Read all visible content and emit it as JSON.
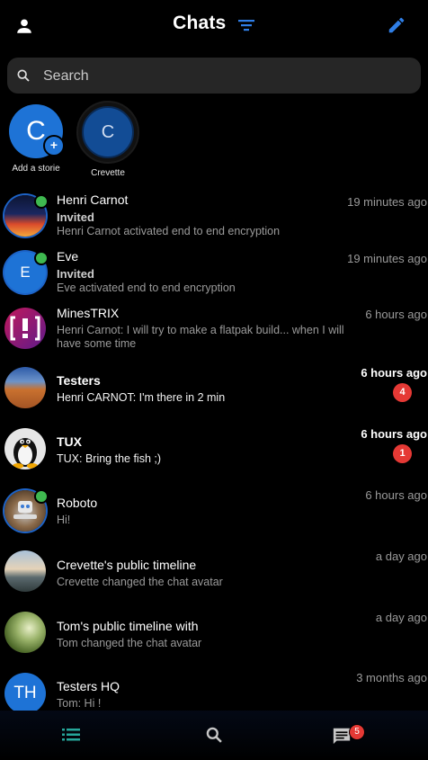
{
  "header": {
    "title": "Chats",
    "account_icon": "person-icon",
    "filter_icon": "filter-icon",
    "compose_icon": "edit-icon"
  },
  "search": {
    "placeholder": "Search"
  },
  "stories": [
    {
      "initial": "C",
      "label": "Add a storie"
    },
    {
      "initial": "C",
      "label": "Crevette"
    }
  ],
  "chats": [
    {
      "name": "Henri Carnot",
      "status": "Invited",
      "preview": "Henri Carnot activated end to end encryption",
      "time": "19 minutes ago"
    },
    {
      "name": "Eve",
      "initial": "E",
      "status": "Invited",
      "preview": "Eve activated end to end encryption",
      "time": "19 minutes ago"
    },
    {
      "name": "MinesTRIX",
      "preview": "Henri Carnot: I will try to make a flatpak build... when I will have some time",
      "time": "6 hours ago"
    },
    {
      "name": "Testers",
      "preview": "Henri CARNOT: I'm there in 2 min",
      "time": "6 hours ago",
      "unread": "4"
    },
    {
      "name": "TUX",
      "preview": "TUX: Bring the fish ;)",
      "time": "6 hours ago",
      "unread": "1"
    },
    {
      "name": "Roboto",
      "preview": "Hi!",
      "time": "6 hours ago"
    },
    {
      "name": "Crevette's public timeline",
      "preview": "Crevette changed the chat avatar",
      "time": "a day ago"
    },
    {
      "name": "Tom's public timeline with",
      "preview": "Tom changed the chat avatar",
      "time": "a day ago"
    },
    {
      "name": "Testers HQ",
      "initial": "TH",
      "preview": "Tom: Hi !",
      "time": "3 months ago"
    }
  ],
  "bottom_nav": {
    "chats_icon": "list-icon",
    "search_icon": "search-icon",
    "messages_icon": "message-icon",
    "messages_badge": "5"
  },
  "colors": {
    "accent": "#1d63c7",
    "nav_active": "#26a69a",
    "badge": "#e53935",
    "online": "#3fb950"
  }
}
